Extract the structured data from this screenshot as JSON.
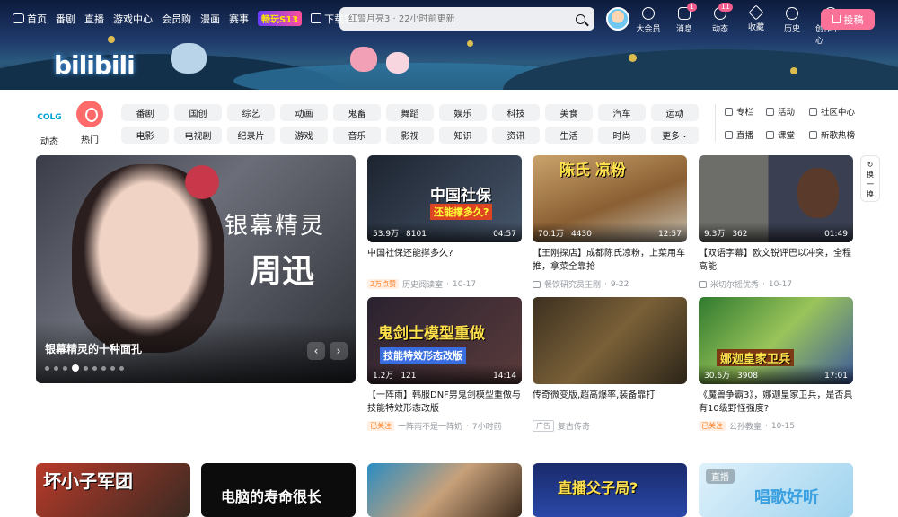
{
  "nav": {
    "items": [
      "首页",
      "番剧",
      "直播",
      "游戏中心",
      "会员购",
      "漫画",
      "赛事"
    ],
    "ad_badge": "畅玩S13",
    "download": "下载客户端"
  },
  "search": {
    "placeholder": "红警月亮3 · 22小时前更新"
  },
  "right_nav": [
    {
      "label": "大会员",
      "icon": "vip-icon",
      "count": ""
    },
    {
      "label": "消息",
      "icon": "message-icon",
      "count": "1"
    },
    {
      "label": "动态",
      "icon": "dynamic-icon",
      "count": "11"
    },
    {
      "label": "收藏",
      "icon": "star-icon",
      "count": ""
    },
    {
      "label": "历史",
      "icon": "clock-icon",
      "count": ""
    },
    {
      "label": "创作中心",
      "icon": "bulb-icon",
      "count": ""
    }
  ],
  "upload": "投稿",
  "logo": "bilibili",
  "channels": {
    "dynamic": {
      "icon_text": "COLG",
      "label": "动态"
    },
    "hot": {
      "label": "热门"
    },
    "chips": [
      "番剧",
      "国创",
      "综艺",
      "动画",
      "鬼畜",
      "舞蹈",
      "娱乐",
      "科技",
      "美食",
      "汽车",
      "运动",
      "电影",
      "电视剧",
      "纪录片",
      "游戏",
      "音乐",
      "影视",
      "知识",
      "资讯",
      "生活",
      "时尚",
      "更多"
    ],
    "side": [
      "专栏",
      "活动",
      "社区中心",
      "直播",
      "课堂",
      "新歌热榜"
    ]
  },
  "carousel": {
    "text1": "银幕精灵",
    "text2": "周迅",
    "caption": "银幕精灵的十种面孔",
    "prev": "‹",
    "next": "›"
  },
  "refresh": "换一换",
  "videos": [
    {
      "thumb": "中国社保",
      "thumb2": "还能撑多久?",
      "views": "53.9万",
      "danmaku": "8101",
      "duration": "04:57",
      "title": "中国社保还能撑多久?",
      "tag": "2万点赞",
      "author": "历史阅读室",
      "date": "10-17"
    },
    {
      "thumb": "陈氏 凉粉",
      "thumb2": "",
      "views": "70.1万",
      "danmaku": "4430",
      "duration": "12:57",
      "title": "【王刚探店】成都陈氏凉粉，上菜用车推，拿菜全靠抢",
      "tag": "",
      "author": "餐饮研究员王刚",
      "date": "9-22"
    },
    {
      "thumb": "",
      "thumb2": "",
      "views": "9.3万",
      "danmaku": "362",
      "duration": "01:49",
      "title": "【双语字幕】欧文锐评巴以冲突，全程高能",
      "tag": "",
      "author": "米切尔摇优秀",
      "date": "10-17"
    },
    {
      "thumb": "鬼剑士模型重做",
      "thumb2": "技能特效形态改版",
      "views": "1.2万",
      "danmaku": "121",
      "duration": "14:14",
      "title": "【一阵雨】韩服DNF男鬼剑模型重做与技能特效形态改版",
      "tag": "已关注",
      "author": "一阵雨不是一阵奶",
      "date": "7小时前"
    },
    {
      "thumb": "",
      "thumb2": "",
      "views": "",
      "danmaku": "",
      "duration": "",
      "title": "传奇微变版,超高爆率,装备靠打",
      "tag": "广告",
      "author": "复古传奇",
      "date": ""
    },
    {
      "thumb": "娜迦皇家卫兵",
      "thumb2": "",
      "views": "30.6万",
      "danmaku": "3908",
      "duration": "17:01",
      "title": "《魔兽争霸3》，娜迦皇家卫兵，是否具有10级野怪强度?",
      "tag": "已关注",
      "author": "公孙教皇",
      "date": "10-15"
    }
  ],
  "bottom_row": [
    {
      "text": "坏小子军团"
    },
    {
      "text": "电脑的寿命很长"
    },
    {
      "text": ""
    },
    {
      "text": "直播父子局?"
    },
    {
      "text": "直播",
      "sub": "唱歌好听"
    }
  ],
  "colors": {
    "accent": "#fb7299",
    "brand_blue": "#00a1d6",
    "chip_bg": "#f1f2f3"
  }
}
